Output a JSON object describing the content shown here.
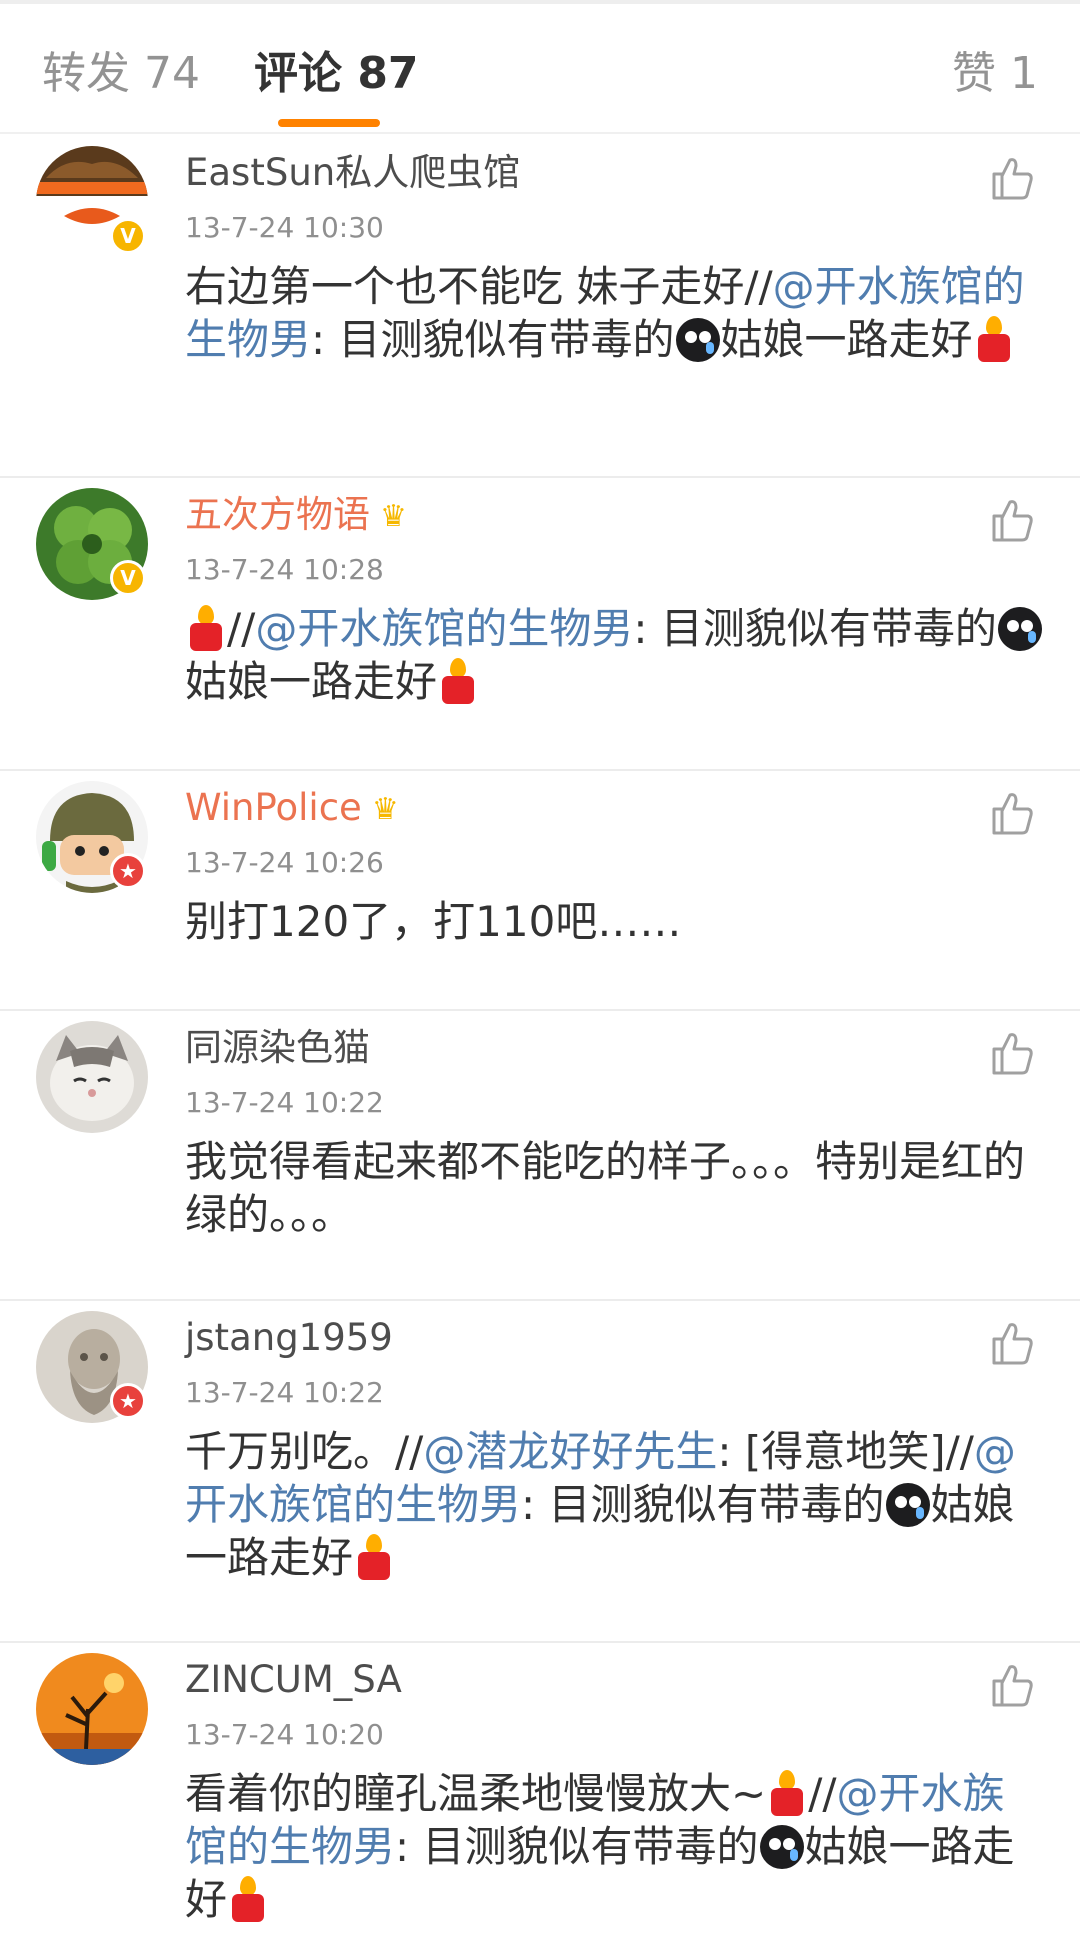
{
  "tabs": {
    "forward": "转发 74",
    "comments": "评论 87",
    "likes": "赞 1"
  },
  "colors": {
    "accent": "#ff8200",
    "mention": "#507daf",
    "vip_name": "#eb7350",
    "verified_badge": "#f7b500",
    "red_badge": "#e8413c"
  },
  "comments": [
    {
      "name": "EastSun私人爬虫馆",
      "time": "13-7-24 10:30",
      "badge": "verified",
      "segments": [
        {
          "t": "text",
          "v": "右边第一个也不能吃 妹子走好//"
        },
        {
          "t": "mention",
          "v": "@开水族馆的生物男"
        },
        {
          "t": "text",
          "v": ": 目测貌似有带毒的"
        },
        {
          "t": "emoji",
          "v": "crying-face"
        },
        {
          "t": "text",
          "v": "姑娘一路走好"
        },
        {
          "t": "emoji",
          "v": "candle"
        }
      ]
    },
    {
      "name": "五次方物语",
      "time": "13-7-24 10:28",
      "badge": "verified",
      "vip": true,
      "segments": [
        {
          "t": "emoji",
          "v": "candle"
        },
        {
          "t": "text",
          "v": "//"
        },
        {
          "t": "mention",
          "v": "@开水族馆的生物男"
        },
        {
          "t": "text",
          "v": ": 目测貌似有带毒的"
        },
        {
          "t": "emoji",
          "v": "crying-face"
        },
        {
          "t": "text",
          "v": "姑娘一路走好"
        },
        {
          "t": "emoji",
          "v": "candle"
        }
      ]
    },
    {
      "name": "WinPolice",
      "time": "13-7-24 10:26",
      "badge": "red",
      "vip": true,
      "segments": [
        {
          "t": "text",
          "v": "别打120了，打110吧……"
        }
      ]
    },
    {
      "name": "同源染色猫",
      "time": "13-7-24 10:22",
      "badge": "none",
      "segments": [
        {
          "t": "text",
          "v": "我觉得看起来都不能吃的样子。。。特别是红的绿的。。。"
        }
      ]
    },
    {
      "name": "jstang1959",
      "time": "13-7-24 10:22",
      "badge": "red",
      "segments": [
        {
          "t": "text",
          "v": "千万别吃。//"
        },
        {
          "t": "mention",
          "v": "@潜龙好好先生"
        },
        {
          "t": "text",
          "v": ": [得意地笑]//"
        },
        {
          "t": "mention",
          "v": "@开水族馆的生物男"
        },
        {
          "t": "text",
          "v": ": 目测貌似有带毒的"
        },
        {
          "t": "emoji",
          "v": "crying-face"
        },
        {
          "t": "text",
          "v": "姑娘一路走好"
        },
        {
          "t": "emoji",
          "v": "candle"
        }
      ]
    },
    {
      "name": "ZINCUM_SA",
      "time": "13-7-24 10:20",
      "badge": "none",
      "segments": [
        {
          "t": "text",
          "v": "看着你的瞳孔温柔地慢慢放大~"
        },
        {
          "t": "emoji",
          "v": "candle"
        },
        {
          "t": "text",
          "v": "//"
        },
        {
          "t": "mention",
          "v": "@开水族馆的生物男"
        },
        {
          "t": "text",
          "v": ": 目测貌似有带毒的"
        },
        {
          "t": "emoji",
          "v": "crying-face"
        },
        {
          "t": "text",
          "v": "姑娘一路走好"
        },
        {
          "t": "emoji",
          "v": "candle"
        }
      ]
    }
  ]
}
